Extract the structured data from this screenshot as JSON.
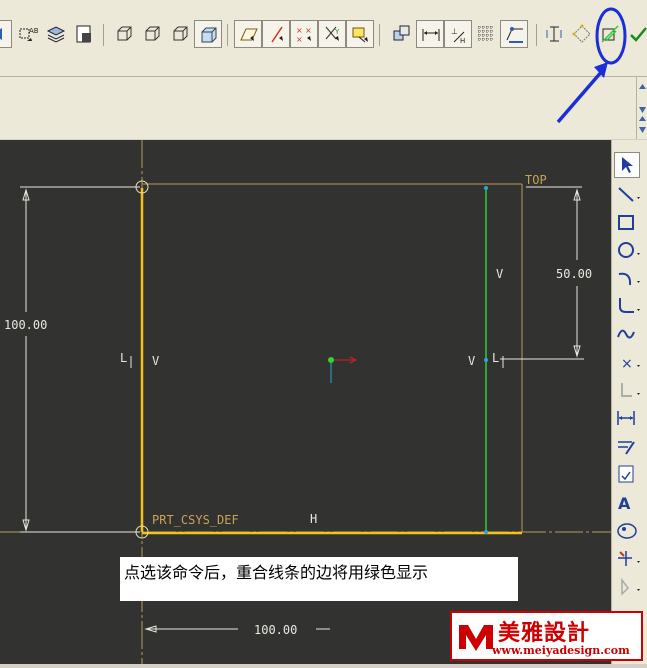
{
  "sketch": {
    "datum_label": "TOP",
    "csys_label": "PRT_CSYS_DEF",
    "dimensions": {
      "width_bottom": "100.00",
      "height_left": "100.00",
      "offset_right": "50.00"
    },
    "constraints": {
      "left_L": "L",
      "left_V": "V",
      "right_V_upper": "V",
      "right_V_mid": "V",
      "right_L": "L",
      "bottom_H": "H"
    }
  },
  "caption": "点选该命令后，重合线条的边将用绿色显示",
  "watermark": {
    "name": "美雅設計",
    "url": "www.meiyadesign.com"
  },
  "colors": {
    "canvas": "#323230",
    "selected_line": "#f2c21a",
    "highlight_green": "#2ecc40",
    "datum_line": "#b89a5a",
    "annotation": "#1a2fd6"
  }
}
